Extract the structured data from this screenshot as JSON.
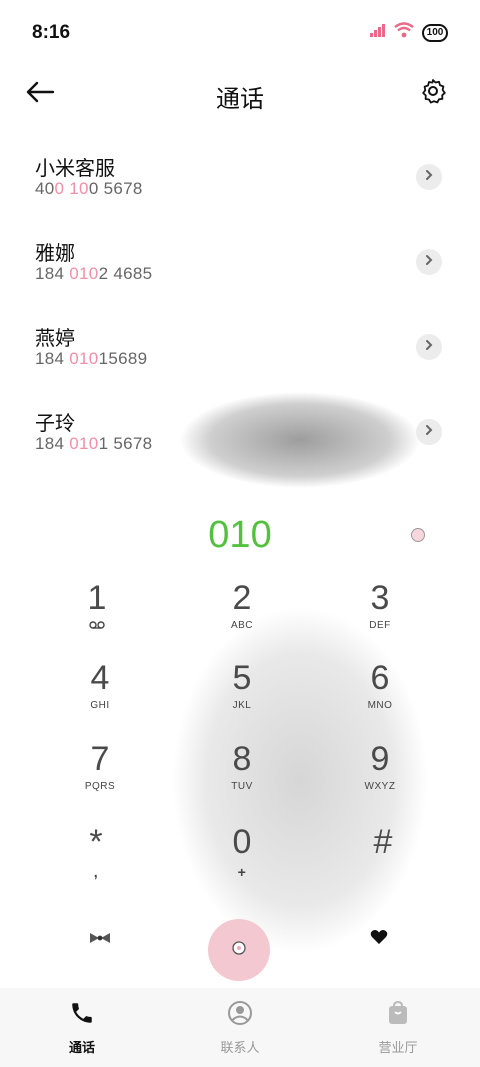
{
  "status_bar": {
    "time": "8:16",
    "battery": "100"
  },
  "header": {
    "title": "通话"
  },
  "results": [
    {
      "name": "小米客服",
      "number_parts": [
        "40",
        "0 10",
        "0 5678"
      ]
    },
    {
      "name": "雅娜",
      "number_parts": [
        "184 ",
        "010",
        "2 4685"
      ]
    },
    {
      "name": "燕婷",
      "number_parts": [
        "184 ",
        "010",
        "15689"
      ]
    },
    {
      "name": "子玲",
      "number_parts": [
        "184 ",
        "010",
        "1 5678"
      ]
    }
  ],
  "dial": {
    "number": "010"
  },
  "keypad": [
    {
      "digit": "1",
      "letters": ""
    },
    {
      "digit": "2",
      "letters": "ABC"
    },
    {
      "digit": "3",
      "letters": "DEF"
    },
    {
      "digit": "4",
      "letters": "GHI"
    },
    {
      "digit": "5",
      "letters": "JKL"
    },
    {
      "digit": "6",
      "letters": "MNO"
    },
    {
      "digit": "7",
      "letters": "PQRS"
    },
    {
      "digit": "8",
      "letters": "TUV"
    },
    {
      "digit": "9",
      "letters": "WXYZ"
    },
    {
      "digit": "*",
      "letters": ","
    },
    {
      "digit": "0",
      "letters": "+"
    },
    {
      "digit": "#",
      "letters": ""
    }
  ],
  "bottom_nav": {
    "tabs": [
      {
        "label": "通话",
        "icon": "phone-icon",
        "active": true
      },
      {
        "label": "联系人",
        "icon": "contacts-icon",
        "active": false
      },
      {
        "label": "营业厅",
        "icon": "store-bag-icon",
        "active": false
      }
    ]
  },
  "colors": {
    "accent_green": "#54c13e",
    "highlight_pink": "#f08fa6",
    "call_button": "#f4c8d0"
  }
}
